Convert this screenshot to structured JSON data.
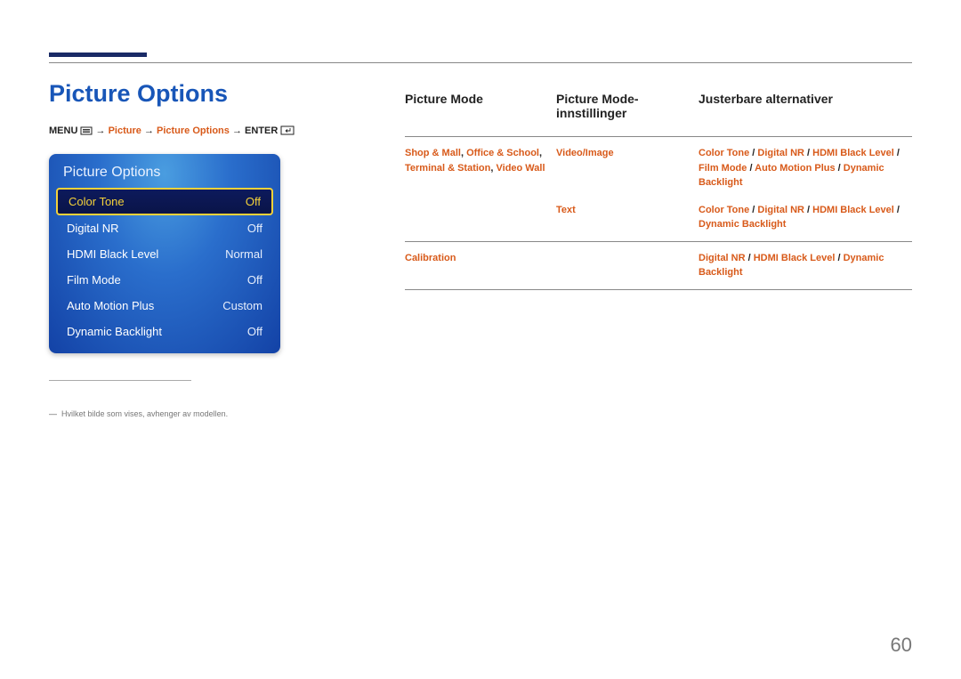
{
  "title": "Picture Options",
  "breadcrumb": {
    "menu": "MENU",
    "arrow": " → ",
    "picture": "Picture",
    "pictureOptions": "Picture Options",
    "enter": "ENTER"
  },
  "osd": {
    "title": "Picture Options",
    "items": [
      {
        "label": "Color Tone",
        "value": "Off",
        "selected": true
      },
      {
        "label": "Digital NR",
        "value": "Off",
        "selected": false
      },
      {
        "label": "HDMI Black Level",
        "value": "Normal",
        "selected": false
      },
      {
        "label": "Film Mode",
        "value": "Off",
        "selected": false
      },
      {
        "label": "Auto Motion Plus",
        "value": "Custom",
        "selected": false
      },
      {
        "label": "Dynamic Backlight",
        "value": "Off",
        "selected": false
      }
    ]
  },
  "footnote": "Hvilket bilde som vises, avhenger av modellen.",
  "table": {
    "headers": {
      "c1": "Picture Mode",
      "c2": "Picture Mode-\ninnstillinger",
      "c3": "Justerbare alternativer"
    },
    "rows": [
      {
        "c1": [
          {
            "t": "Shop & Mall",
            "c": "orange"
          },
          {
            "t": ", ",
            "c": "black"
          },
          {
            "t": "Office & School",
            "c": "orange"
          },
          {
            "t": ", ",
            "c": "black"
          },
          {
            "t": "Terminal & Station",
            "c": "orange"
          },
          {
            "t": ", ",
            "c": "black"
          },
          {
            "t": "Video Wall",
            "c": "orange"
          }
        ],
        "sub": [
          {
            "c2": [
              {
                "t": "Video/Image",
                "c": "orange"
              }
            ],
            "c3": [
              {
                "t": "Color Tone",
                "c": "orange"
              },
              {
                "t": " / ",
                "c": "black"
              },
              {
                "t": "Digital NR",
                "c": "orange"
              },
              {
                "t": " / ",
                "c": "black"
              },
              {
                "t": "HDMI Black Level",
                "c": "orange"
              },
              {
                "t": " / ",
                "c": "black"
              },
              {
                "t": "Film Mode",
                "c": "orange"
              },
              {
                "t": " / ",
                "c": "black"
              },
              {
                "t": "Auto Motion Plus",
                "c": "orange"
              },
              {
                "t": " / ",
                "c": "black"
              },
              {
                "t": "Dynamic Backlight",
                "c": "orange"
              }
            ]
          },
          {
            "c2": [
              {
                "t": "Text",
                "c": "orange"
              }
            ],
            "c3": [
              {
                "t": "Color Tone",
                "c": "orange"
              },
              {
                "t": " / ",
                "c": "black"
              },
              {
                "t": "Digital NR",
                "c": "orange"
              },
              {
                "t": " / ",
                "c": "black"
              },
              {
                "t": "HDMI Black Level",
                "c": "orange"
              },
              {
                "t": " / ",
                "c": "black"
              },
              {
                "t": "Dynamic Backlight",
                "c": "orange"
              }
            ]
          }
        ]
      },
      {
        "c1": [
          {
            "t": "Calibration",
            "c": "orange"
          }
        ],
        "sub": [
          {
            "c2": [],
            "c3": [
              {
                "t": "Digital NR",
                "c": "orange"
              },
              {
                "t": " / ",
                "c": "black"
              },
              {
                "t": "HDMI Black Level",
                "c": "orange"
              },
              {
                "t": " / ",
                "c": "black"
              },
              {
                "t": "Dynamic Backlight",
                "c": "orange"
              }
            ]
          }
        ]
      }
    ]
  },
  "pageNumber": "60"
}
